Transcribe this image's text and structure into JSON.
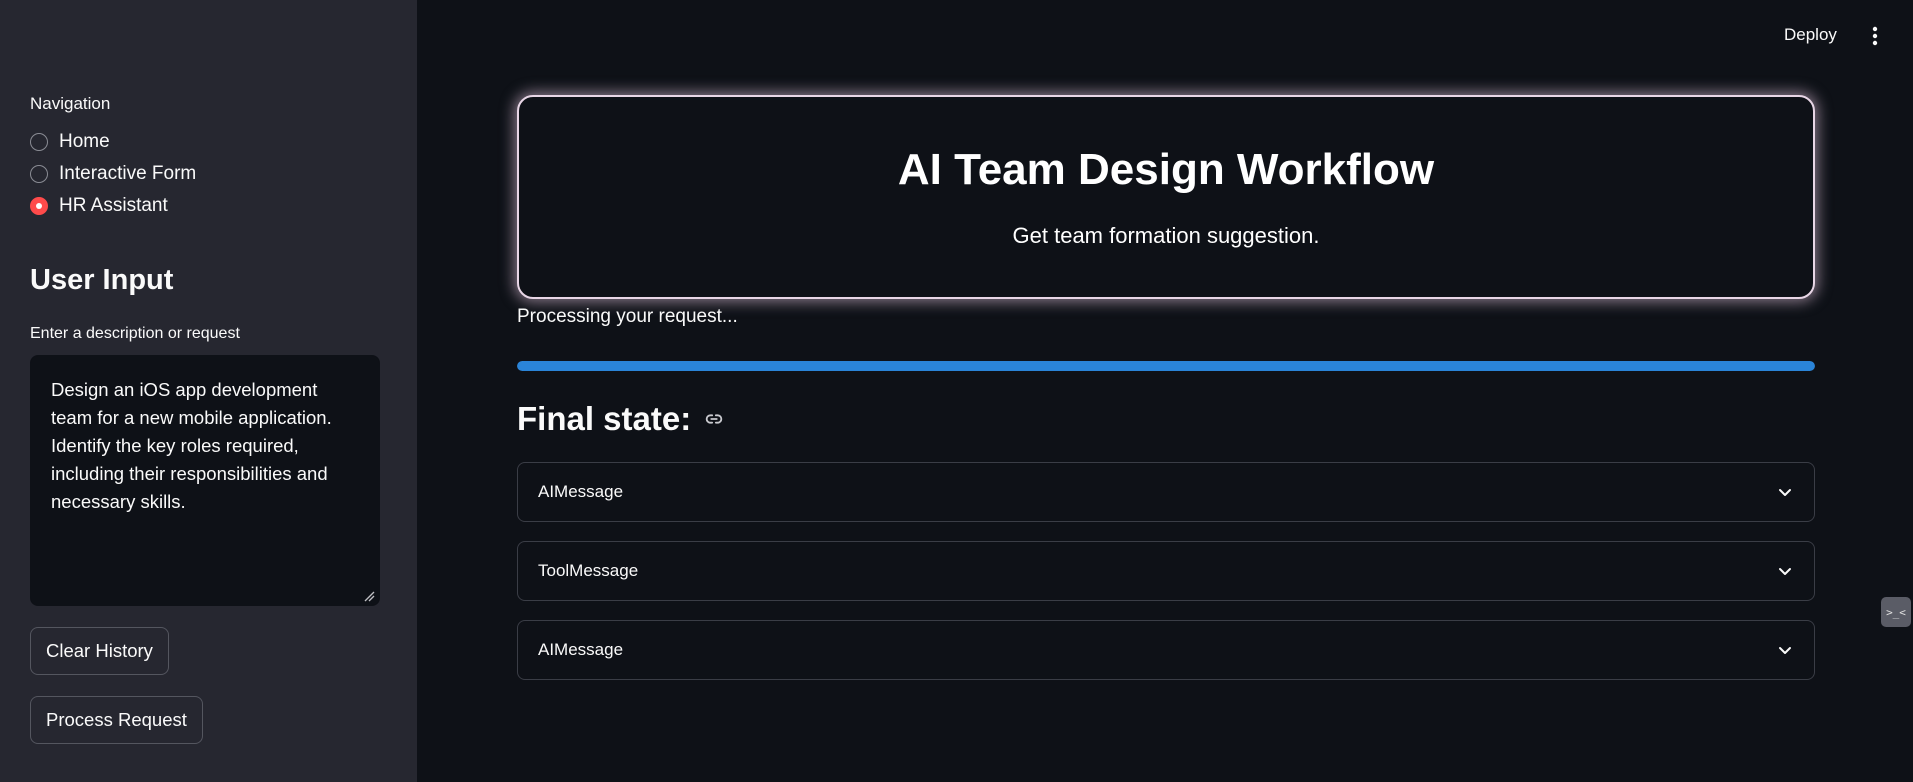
{
  "header": {
    "deploy_label": "Deploy"
  },
  "sidebar": {
    "nav_title": "Navigation",
    "nav_items": [
      {
        "label": "Home",
        "selected": false
      },
      {
        "label": "Interactive Form",
        "selected": false
      },
      {
        "label": "HR Assistant",
        "selected": true
      }
    ],
    "user_input_heading": "User Input",
    "textarea_label": "Enter a description or request",
    "textarea_value": "Design an iOS app development team for a new mobile application. Identify the key roles required, including their responsibilities and necessary skills.",
    "clear_button": "Clear History",
    "process_button": "Process Request"
  },
  "main": {
    "hero_title": "AI Team Design Workflow",
    "hero_subtitle": "Get team formation suggestion.",
    "status_text": "Processing your request...",
    "progress_fraction": 1.0,
    "final_heading": "Final state:",
    "expanders": [
      {
        "label": "AIMessage"
      },
      {
        "label": "ToolMessage"
      },
      {
        "label": "AIMessage"
      }
    ]
  },
  "side_tab_glyph": ">_<",
  "colors": {
    "accent": "#ff4b4b",
    "progress": "#2a84d8",
    "sidebar_bg": "#262730",
    "main_bg": "#0e1117"
  },
  "icons": [
    "kebab-menu-icon",
    "link-icon",
    "chevron-down-icon",
    "resize-handle-icon"
  ]
}
